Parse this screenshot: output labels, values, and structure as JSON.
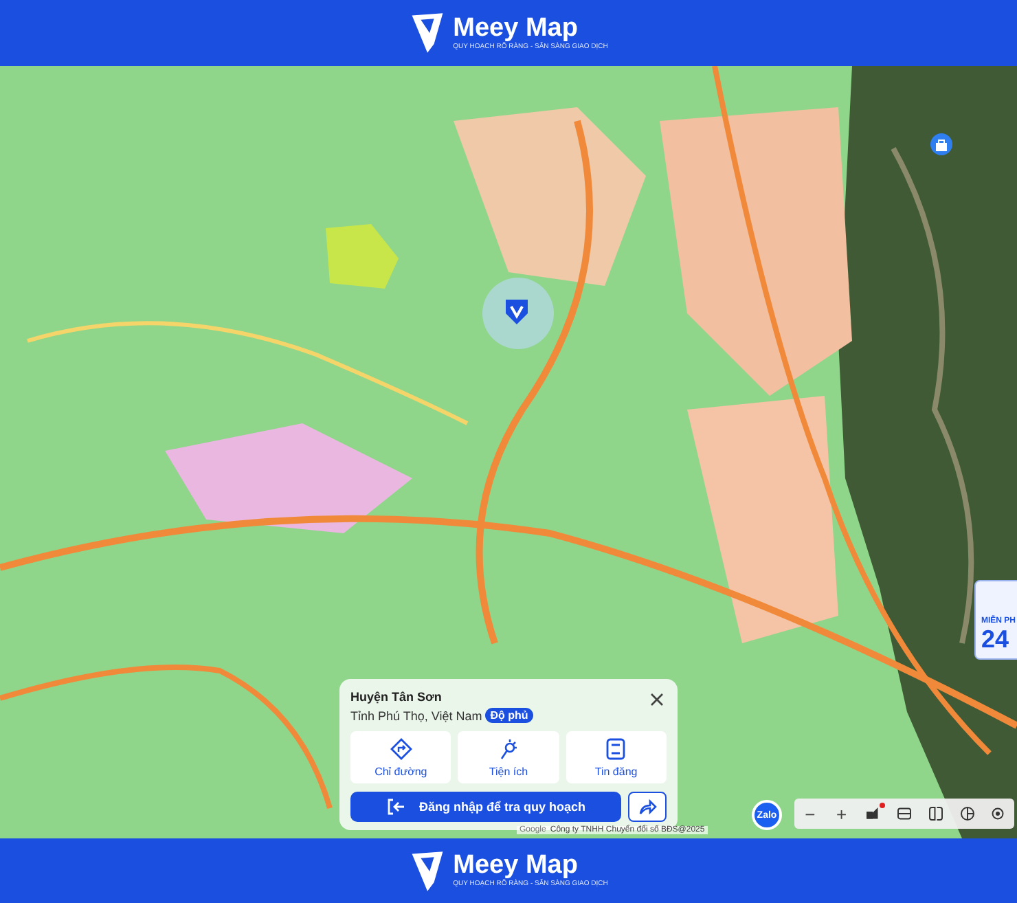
{
  "header": {
    "brand": "Meey Map",
    "tagline": "QUY HOẠCH RÕ RÀNG - SẴN SÀNG GIAO DỊCH"
  },
  "map": {
    "attribution": "Công ty TNHH Chuyển đổi số BĐS@2025",
    "attribution_logo": "Google"
  },
  "place_card": {
    "title": "Huyện Tân Sơn",
    "subtitle": "Tỉnh Phú Thọ, Việt Nam",
    "badge": "Độ phủ",
    "actions": [
      {
        "kind": "directions",
        "label": "Chỉ đường"
      },
      {
        "kind": "amenities",
        "label": "Tiện ích"
      },
      {
        "kind": "listings",
        "label": "Tin đăng"
      }
    ],
    "login_button": "Đăng nhập để tra quy hoạch"
  },
  "zalo_button": "Zalo",
  "toolbar": [
    {
      "kind": "zoom-out",
      "label": "−"
    },
    {
      "kind": "zoom-in",
      "label": "+"
    },
    {
      "kind": "layers",
      "alert": true
    },
    {
      "kind": "ruler"
    },
    {
      "kind": "split"
    },
    {
      "kind": "pie"
    },
    {
      "kind": "locate"
    }
  ],
  "promo": {
    "line_1": "MIỄN PH",
    "line_2": "24"
  },
  "footer": {
    "brand": "Meey Map",
    "tagline": "QUY HOẠCH RÕ RÀNG - SẴN SÀNG GIAO DỊCH"
  }
}
